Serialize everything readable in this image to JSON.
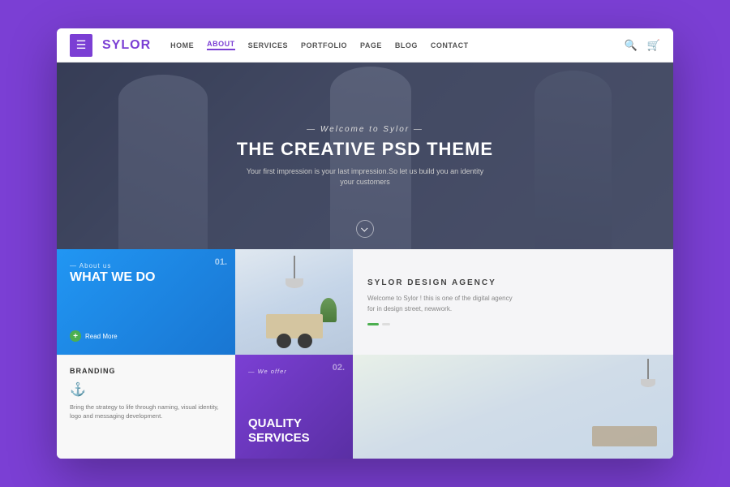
{
  "page": {
    "bg_color": "#7b3fd4"
  },
  "navbar": {
    "hamburger_icon": "☰",
    "logo_text": "SYL",
    "logo_accent": "OR",
    "nav_items": [
      {
        "label": "HOME",
        "active": false
      },
      {
        "label": "ABOUT",
        "active": true
      },
      {
        "label": "SERVICES",
        "active": false
      },
      {
        "label": "PORTFOLIO",
        "active": false
      },
      {
        "label": "PAGE",
        "active": false
      },
      {
        "label": "BLOG",
        "active": false
      },
      {
        "label": "CONTACT",
        "active": false
      }
    ],
    "search_icon": "🔍",
    "cart_icon": "🛒"
  },
  "hero": {
    "subtitle": "Welcome to Sylor",
    "title": "THE CREATIVE PSD THEME",
    "description": "Your first impression is your last impression.So let us build you an identity  your customers"
  },
  "what_we_do": {
    "number": "01.",
    "label": "About us",
    "title": "WHAT WE DO",
    "read_more": "Read More"
  },
  "agency": {
    "title": "SYLOR DESIGN AGENCY",
    "description": "Welcome to Sylor ! this is one of the digital agency for in design street, newwork."
  },
  "branding": {
    "title": "BRANDING",
    "description": "Bring the strategy to life through naming, visual identity, logo and messaging development."
  },
  "quality_services": {
    "number": "02.",
    "label": "We offer",
    "title": "QUALITY SERVICES"
  }
}
